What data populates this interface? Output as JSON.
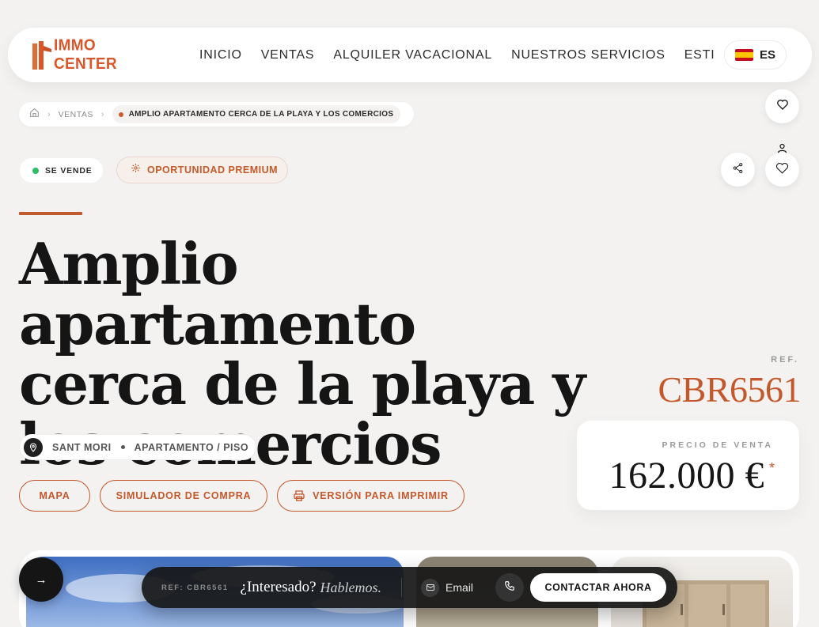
{
  "brand": {
    "name": "IMMO CENTER",
    "accent": "#c5582b"
  },
  "nav": {
    "items": [
      "INICIO",
      "VENTAS",
      "ALQUILER VACACIONAL",
      "NUESTROS SERVICIOS",
      "ESTIMA"
    ],
    "language": "ES",
    "flag_icon": "spain-flag-icon"
  },
  "breadcrumb": {
    "home_icon": "home-icon",
    "section": "VENTAS",
    "current": "AMPLIO APARTAMENTO CERCA DE LA PLAYA Y LOS COMERCIOS"
  },
  "badges": {
    "status": "SE VENDE",
    "status_color": "#2bbf61",
    "premium": "OPORTUNIDAD PREMIUM"
  },
  "property": {
    "title_line1": "Amplio apartamento",
    "title_line2": "cerca de la playa y",
    "title_line3": "los comercios",
    "location": "SANT MORI",
    "type": "APARTAMENTO / PISO",
    "ref_label": "REF.",
    "ref": "CBR6561",
    "price_label": "PRECIO DE VENTA",
    "price": "162.000 €",
    "price_mark": "*"
  },
  "actions": {
    "map": "MAPA",
    "simulator": "SIMULADOR DE COMPRA",
    "print": "VERSIÓN PARA IMPRIMIR"
  },
  "contact_bar": {
    "ref": "REF: CBR6561",
    "interest": "¿Interesado?",
    "talk": "Hablemos.",
    "email": "Email",
    "contact_now": "CONTACTAR AHORA"
  },
  "gallery": {
    "next_arrow": "→"
  }
}
